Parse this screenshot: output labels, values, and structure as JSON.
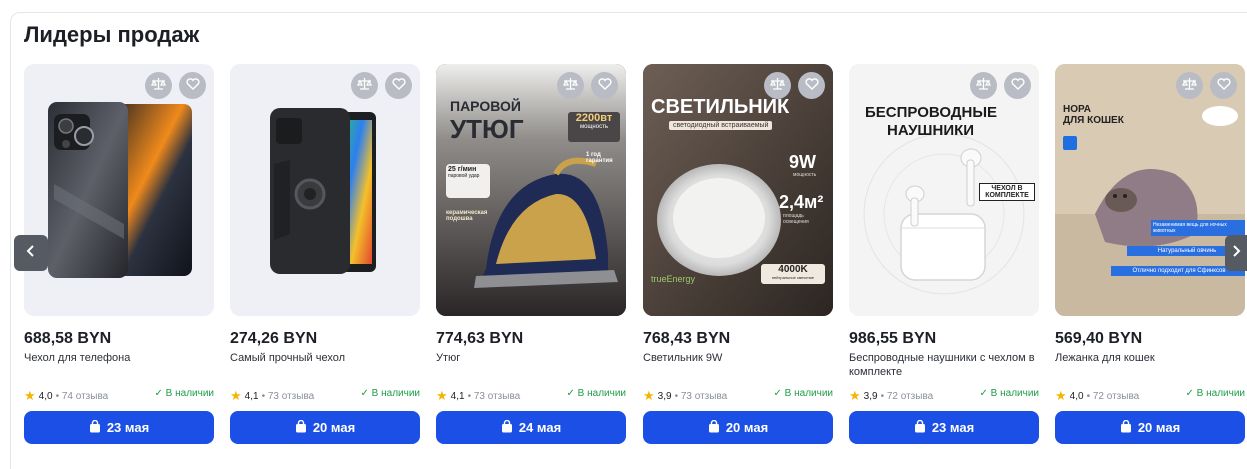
{
  "section": {
    "title": "Лидеры продаж"
  },
  "icons": {
    "compare": "scale-icon",
    "favorite": "heart-icon",
    "delivery": "bag-icon",
    "star": "star-icon"
  },
  "colors": {
    "button": "#1b4fe6",
    "in_stock": "#1f9e47",
    "star": "#f4b400"
  },
  "products": [
    {
      "price": "688,58 BYN",
      "name": "Чехол для телефона",
      "rating": "4,0",
      "reviews": "74 отзыва",
      "stock": "✓ В наличии",
      "delivery": "23 мая",
      "image": {}
    },
    {
      "price": "274,26 BYN",
      "name": "Самый прочный чехол",
      "rating": "4,1",
      "reviews": "73 отзыва",
      "stock": "✓ В наличии",
      "delivery": "20 мая",
      "image": {}
    },
    {
      "price": "774,63 BYN",
      "name": "Утюг",
      "rating": "4,1",
      "reviews": "73 отзыва",
      "stock": "✓ В наличии",
      "delivery": "24 мая",
      "image": {
        "title1": "ПАРОВОЙ",
        "title2": "УТЮГ",
        "badge_power": "2200вт",
        "badge_power_sub": "мощность",
        "badge_warranty": "1 год гарантия",
        "steam": "25 г/мин",
        "steam_sub": "паровой удар",
        "sole": "керамическая подошва"
      }
    },
    {
      "price": "768,43 BYN",
      "name": "Светильник 9W",
      "rating": "3,9",
      "reviews": "73 отзыва",
      "stock": "✓ В наличии",
      "delivery": "20 мая",
      "image": {
        "title": "СВЕТИЛЬНИК",
        "subtitle": "светодиодный встраиваемый",
        "power": "9W",
        "power_sub": "мощность",
        "area": "2,4м²",
        "area_sub": "площадь освещения",
        "temp": "4000K",
        "temp_sub": "нейтральное свечение",
        "brand": "trueEnergy"
      }
    },
    {
      "price": "986,55 BYN",
      "name": "Беспроводные наушники с чехлом в комплекте",
      "rating": "3,9",
      "reviews": "72 отзыва",
      "stock": "✓ В наличии",
      "delivery": "23 мая",
      "image": {
        "title1": "БЕСПРОВОДНЫЕ",
        "title2": "НАУШНИКИ",
        "case_note": "ЧЕХОЛ В КОМПЛЕКТЕ"
      }
    },
    {
      "price": "569,40 BYN",
      "name": "Лежанка для кошек",
      "rating": "4,0",
      "reviews": "72 отзыва",
      "stock": "✓ В наличии",
      "delivery": "20 мая",
      "image": {
        "title1": "НОРА",
        "title2": "ДЛЯ КОШЕК",
        "feature1": "Незаменимая вещь для ночных животных",
        "feature2": "Натуральный овчинь",
        "feature3": "Отлично подходит для Сфинксов"
      }
    }
  ]
}
